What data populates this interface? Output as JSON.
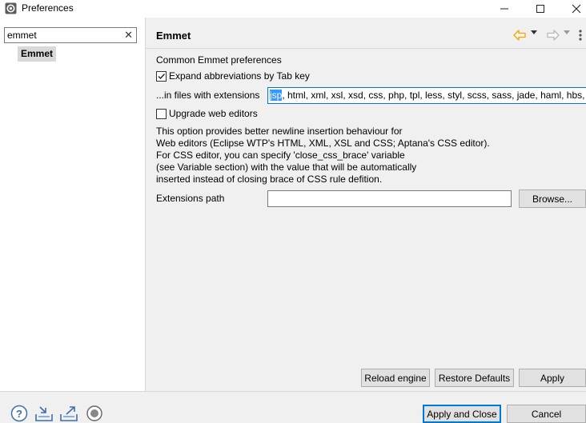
{
  "window": {
    "title": "Preferences",
    "icon": "eclipse-preferences-icon",
    "minimize_symbol": "—",
    "maximize_symbol": "☐",
    "close_symbol": "✕"
  },
  "sidebar": {
    "filter_value": "emmet",
    "clear_symbol": "✕",
    "items": [
      {
        "label": "Emmet",
        "selected": true
      }
    ]
  },
  "page": {
    "title": "Emmet",
    "nav_icons": [
      "back-arrow-icon",
      "forward-arrow-icon",
      "view-menu-icon"
    ],
    "section_label": "Common Emmet preferences",
    "expand_abbreviations": {
      "label": "Expand abbreviations by Tab key",
      "checked": true
    },
    "extensions_label": "...in files with extensions",
    "extensions_selected": "jsp",
    "extensions_rest": ", html, xml, xsl, xsd, css, php, tpl, less, styl, scss, sass, jade, haml, hbs,",
    "upgrade_editors": {
      "label": "Upgrade web editors",
      "checked": false
    },
    "description": "This option provides better newline insertion behaviour for\nWeb editors (Eclipse WTP's HTML, XML, XSL and CSS; Aptana's CSS editor).\nFor CSS editor, you can specify 'close_css_brace' variable\n(see Variable section) with the value that will be automatically\ninserted instead of closing brace of CSS rule defition.",
    "extensions_path_label": "Extensions path",
    "extensions_path_value": "",
    "browse_label": "Browse..."
  },
  "page_buttons": {
    "reload": "Reload engine",
    "restore": "Restore Defaults",
    "apply": "Apply"
  },
  "footer": {
    "icons": [
      "help-icon",
      "import-icon",
      "export-icon",
      "record-icon"
    ],
    "apply_close": "Apply and Close",
    "cancel": "Cancel"
  },
  "colors": {
    "accent": "#0078d7",
    "selection": "#3399ff",
    "nav_back": "#f2a30f"
  }
}
